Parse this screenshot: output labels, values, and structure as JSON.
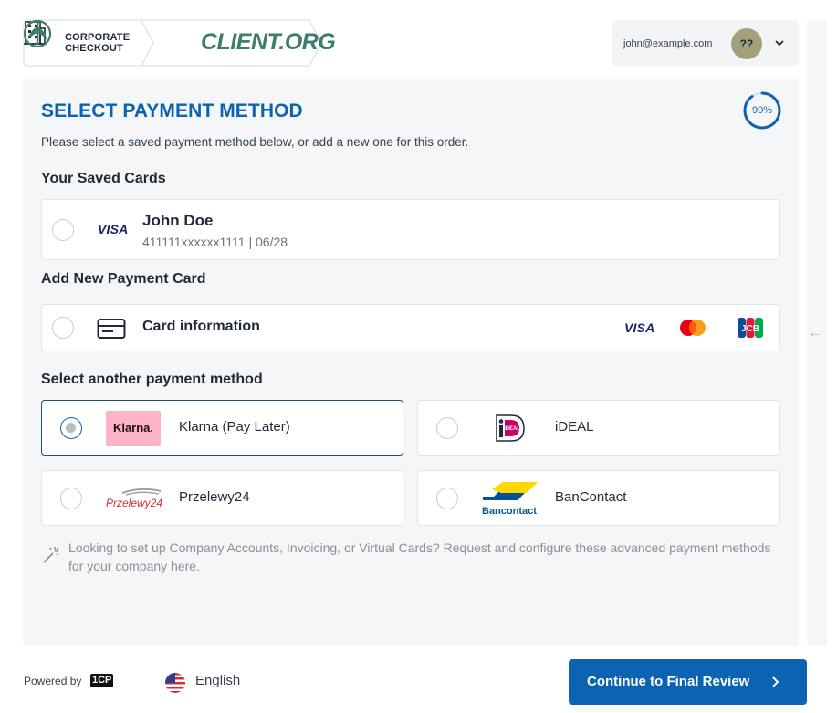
{
  "header": {
    "corporate_line1": "CORPORATE",
    "corporate_line2": "CHECKOUT",
    "client_name": "CLIENT.ORG"
  },
  "user": {
    "email": "john@example.com",
    "avatar_initials": "??"
  },
  "progress": {
    "percent": 90,
    "label": "90%"
  },
  "main": {
    "title": "SELECT PAYMENT METHOD",
    "subtitle": "Please select a saved payment method below, or add a new one for this order."
  },
  "saved_cards": {
    "heading": "Your Saved Cards",
    "cards": [
      {
        "brand": "VISA",
        "holder": "John Doe",
        "details": "411111xxxxxx1111 | 06/28",
        "selected": false
      }
    ]
  },
  "new_card": {
    "heading": "Add New Payment Card",
    "label": "Card information",
    "brands": [
      "VISA",
      "mastercard-icon",
      "JCB"
    ]
  },
  "other_methods": {
    "heading": "Select another payment method",
    "methods": [
      {
        "logo": "Klarna.",
        "label": "Klarna (Pay Later)",
        "selected": true
      },
      {
        "logo": "iDEAL",
        "label": "iDEAL",
        "selected": false
      },
      {
        "logo": "Przelewy24",
        "label": "Przelewy24",
        "selected": false
      },
      {
        "logo": "Bancontact",
        "label": "BanContact",
        "selected": false
      }
    ]
  },
  "note": "Looking to set up Company Accounts, Invoicing, or Virtual Cards? Request and configure these advanced payment methods for your company here.",
  "footer": {
    "powered_by": "Powered by",
    "powered_brand": "1CP",
    "language": "English",
    "continue_label": "Continue to Final Review"
  },
  "colors": {
    "primary": "#0b63b1",
    "panel_bg": "#f5f6f8",
    "klarna_pink": "#ffb3c7",
    "client_green": "#3f7d6a"
  }
}
